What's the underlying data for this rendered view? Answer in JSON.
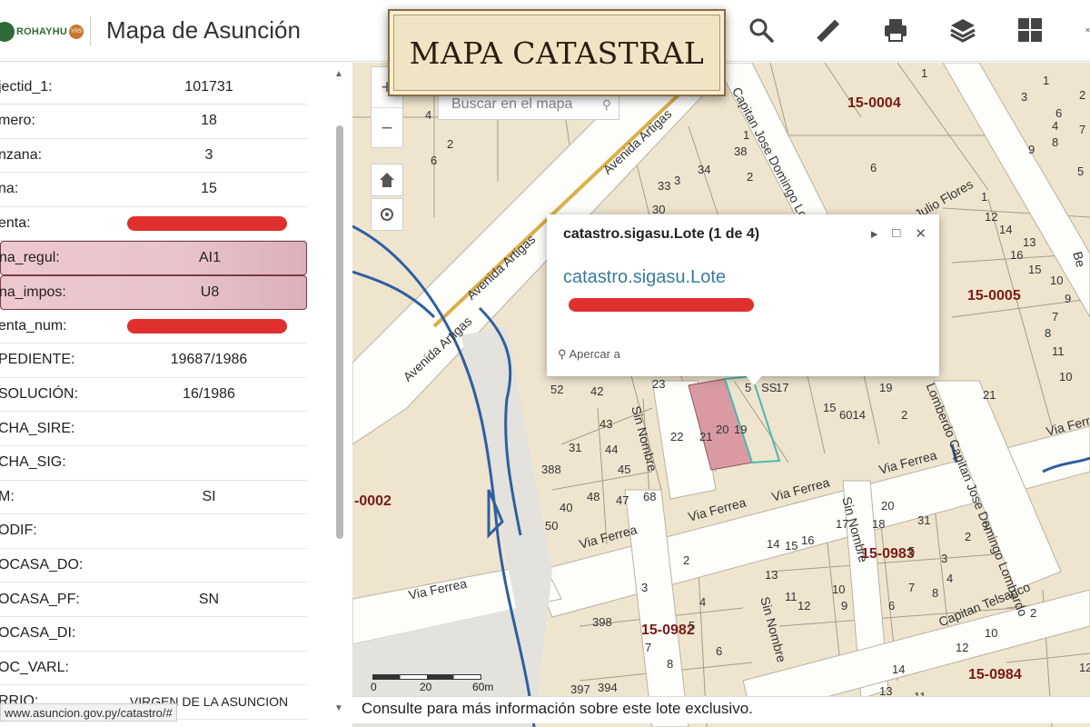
{
  "header": {
    "logo_text": "ROHAYHU",
    "logo_badge": "YRS",
    "title": "Mapa de Asunción",
    "banner": "MAPA CATASTRAL",
    "buttons": [
      "search-icon",
      "measure-icon",
      "print-icon",
      "layers-icon",
      "grid-icon",
      "more-icon"
    ]
  },
  "attributes": {
    "rows": [
      {
        "key": "jectid_1:",
        "value": "101731"
      },
      {
        "key": "mero:",
        "value": "18"
      },
      {
        "key": "nzana:",
        "value": "3"
      },
      {
        "key": "na:",
        "value": "15"
      },
      {
        "key": "enta:",
        "value": "",
        "redacted": true
      },
      {
        "key": "na_regul:",
        "value": "AI1",
        "highlight": true
      },
      {
        "key": "na_impos:",
        "value": "U8",
        "highlight": true
      },
      {
        "key": "enta_num:",
        "value": "",
        "redacted": true
      },
      {
        "key": "PEDIENTE:",
        "value": "19687/1986"
      },
      {
        "key": "SOLUCIÓN:",
        "value": "16/1986"
      },
      {
        "key": "CHA_SIRE:",
        "value": ""
      },
      {
        "key": "CHA_SIG:",
        "value": ""
      },
      {
        "key": "M:",
        "value": "SI"
      },
      {
        "key": "ODIF:",
        "value": ""
      },
      {
        "key": "OCASA_DO:",
        "value": ""
      },
      {
        "key": "OCASA_PF:",
        "value": "SN"
      },
      {
        "key": "OCASA_DI:",
        "value": ""
      },
      {
        "key": "OC_VARL:",
        "value": ""
      },
      {
        "key": "RRIO:",
        "value": "VIRGEN DE LA ASUNCION"
      }
    ],
    "status_url": "www.asuncion.gov.py/catastro/#"
  },
  "map": {
    "search_placeholder": "Buscar en el mapa",
    "zoom_in": "+",
    "zoom_out": "−",
    "popup": {
      "title": "catastro.sigasu.Lote (1 de 4)",
      "link": "catastro.sigasu.Lote",
      "zoom_label": "Apercar a"
    },
    "zones": [
      "15-0004",
      "15-0005",
      "-0002",
      "15-0983",
      "15-0982",
      "15-0984",
      "15-0982"
    ],
    "roads": [
      "Avenida Artigas",
      "Avenida Artigas",
      "Avenida Artigas",
      "Capitan Jose Domingo Lombardo",
      "Julio Flores",
      "Via Ferrea",
      "Via Ferrea",
      "Via Ferrea",
      "Via Ferrea",
      "Via Ferrea",
      "Via Ferrea",
      "Sin Nombre",
      "Sin Nombre",
      "Sin Nombre",
      "Lomberdo Capitan Jose Domingo Lombardo",
      "Capitan Telsanco",
      "Be"
    ],
    "lot_numbers": [
      "1",
      "5",
      "3",
      "4",
      "6",
      "2",
      "1",
      "2",
      "3",
      "6",
      "4",
      "8",
      "9",
      "7",
      "5",
      "38",
      "1",
      "34",
      "33",
      "2",
      "30",
      "3",
      "6",
      "1",
      "12",
      "14",
      "13",
      "16",
      "15",
      "10",
      "9",
      "7",
      "8",
      "11",
      "10",
      "21",
      "23",
      "5",
      "SS",
      "17",
      "15",
      "19",
      "6014",
      "2",
      "22",
      "21",
      "20",
      "19",
      "52",
      "42",
      "43",
      "31",
      "44",
      "45",
      "48",
      "47",
      "68",
      "40",
      "50",
      "388",
      "14",
      "15",
      "16",
      "17",
      "18",
      "20",
      "31",
      "13",
      "11",
      "12",
      "10",
      "9",
      "6",
      "7",
      "8",
      "4",
      "5",
      "3",
      "2",
      "1",
      "398",
      "2",
      "3",
      "4",
      "5",
      "6",
      "7",
      "8",
      "397",
      "394",
      "12",
      "14",
      "13",
      "11",
      "12",
      "10",
      "2"
    ],
    "scale_labels": [
      "0",
      "20",
      "60m"
    ],
    "footer": "Consulte para más información sobre este lote exclusivo."
  },
  "colors": {
    "parcel": "#efe5cf",
    "road": "#fdfdfa",
    "water": "#2f5fa0",
    "zone_label": "#7a1a16",
    "selected_lot": "#d99aa3",
    "redaction": "#e0302e"
  }
}
